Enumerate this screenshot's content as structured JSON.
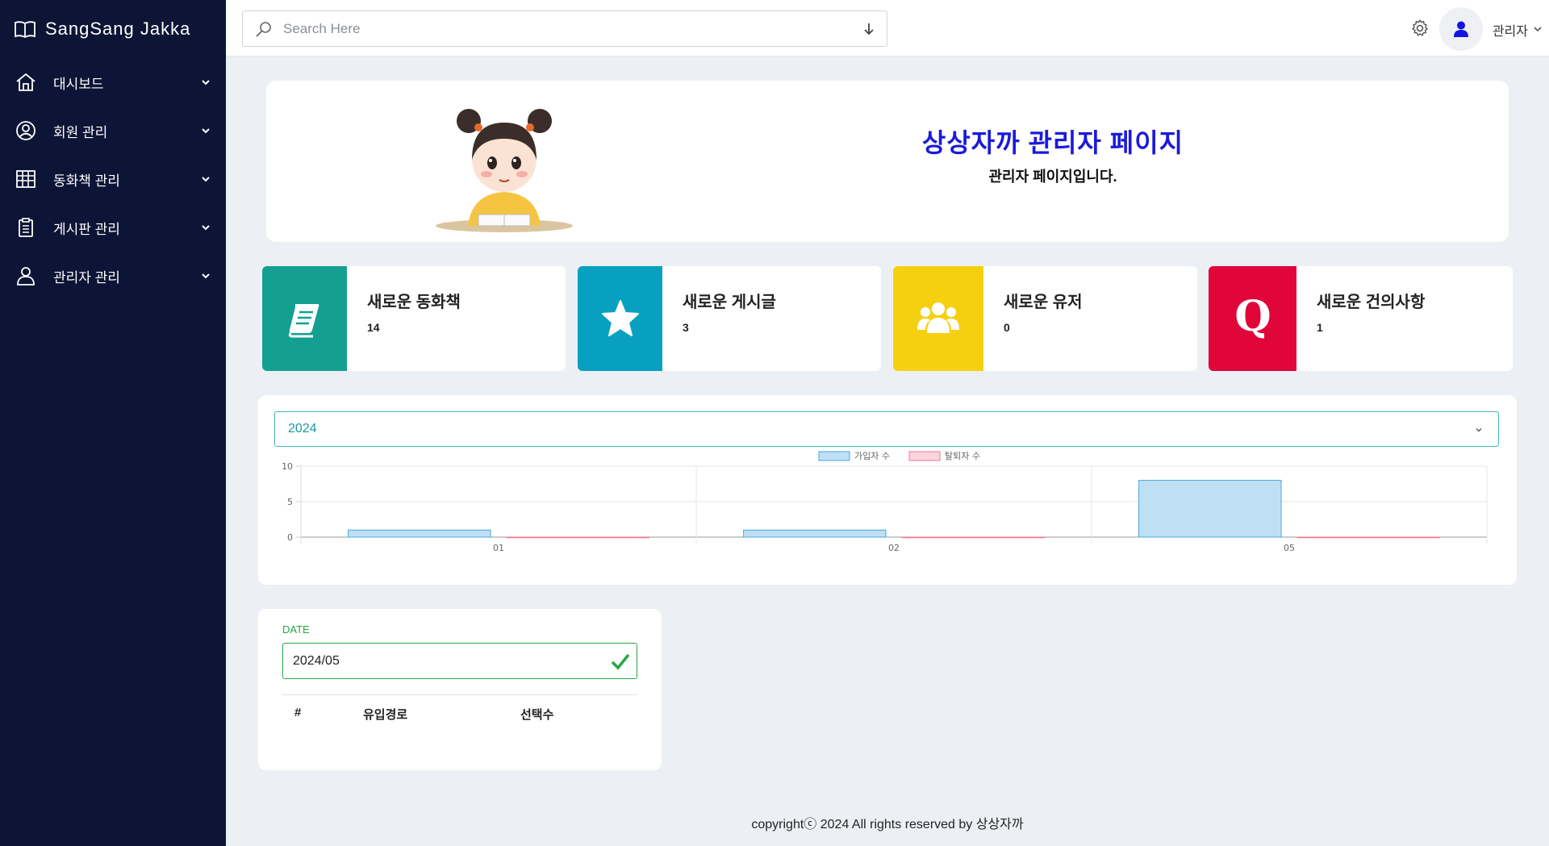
{
  "app": {
    "brand": "SangSang Jakka"
  },
  "sidebar": {
    "items": [
      {
        "label": "대시보드",
        "icon": "home-icon"
      },
      {
        "label": "회원 관리",
        "icon": "user-circle-icon"
      },
      {
        "label": "동화책 관리",
        "icon": "table-icon"
      },
      {
        "label": "게시판 관리",
        "icon": "clipboard-icon"
      },
      {
        "label": "관리자 관리",
        "icon": "user-icon"
      }
    ]
  },
  "topbar": {
    "search_placeholder": "Search Here",
    "user_name": "관리자"
  },
  "hero": {
    "title": "상상자까 관리자 페이지",
    "subtitle": "관리자 페이지입니다."
  },
  "stats": [
    {
      "label": "새로운 동화책",
      "value": "14",
      "color": "#14a090",
      "icon": "book-icon"
    },
    {
      "label": "새로운 게시글",
      "value": "3",
      "color": "#08a0c0",
      "icon": "star-icon"
    },
    {
      "label": "새로운 유저",
      "value": "0",
      "color": "#f5d010",
      "icon": "users-icon"
    },
    {
      "label": "새로운 건의사항",
      "value": "1",
      "color": "#e0063a",
      "icon": "q-icon"
    }
  ],
  "chart": {
    "year": "2024"
  },
  "chart_data": {
    "type": "bar",
    "categories": [
      "01",
      "02",
      "05"
    ],
    "series": [
      {
        "name": "가입자 수",
        "values": [
          1,
          1,
          8
        ],
        "color": "#bfe0f4",
        "border": "#4aa8dd"
      },
      {
        "name": "탈퇴자 수",
        "values": [
          0,
          0,
          0
        ],
        "color": "#fcd5dc",
        "border": "#f07890"
      }
    ],
    "ylim": [
      0,
      10
    ],
    "yticks": [
      "10",
      "5",
      "0"
    ],
    "legend": "top-center",
    "grid": true
  },
  "date_panel": {
    "label": "DATE",
    "value": "2024/05",
    "columns": [
      "#",
      "유입경로",
      "선택수"
    ]
  },
  "footer": {
    "text": "copyrightⓒ 2024 All rights reserved by 상상자까"
  }
}
